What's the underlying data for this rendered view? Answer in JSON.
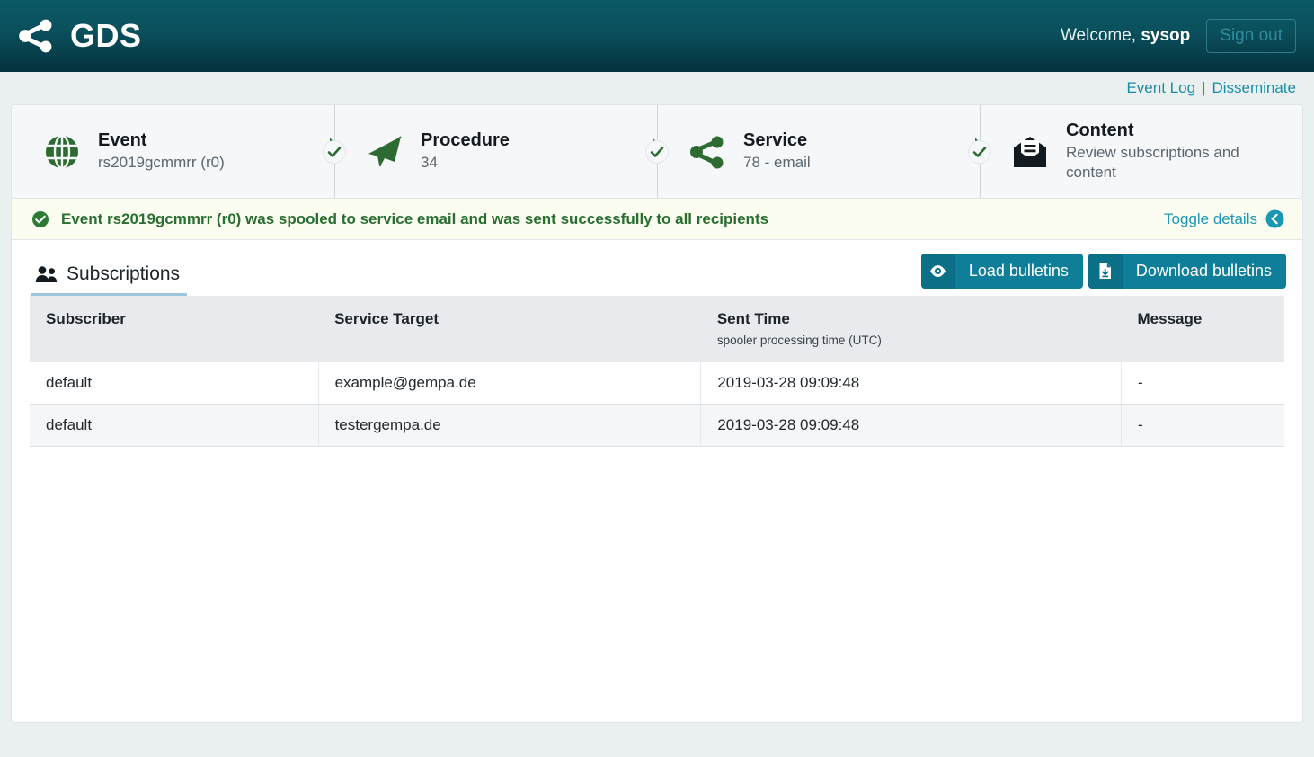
{
  "header": {
    "logo_icon": "share-nodes-icon",
    "title": "GDS",
    "welcome_prefix": "Welcome, ",
    "username": "sysop",
    "signout_label": "Sign out",
    "brand_color": "#04323d",
    "accent_color": "#0e7e99"
  },
  "nav": {
    "links": [
      {
        "label": "Event Log"
      },
      {
        "label": "Disseminate"
      }
    ],
    "separator": "|"
  },
  "steps": [
    {
      "icon": "globe-icon",
      "title": "Event",
      "subtitle": "rs2019gcmmrr (r0)",
      "completed": true
    },
    {
      "icon": "paper-plane-icon",
      "title": "Procedure",
      "subtitle": "34",
      "completed": true
    },
    {
      "icon": "share-nodes-icon",
      "title": "Service",
      "subtitle": "78 - email",
      "completed": true
    },
    {
      "icon": "envelope-open-text-icon",
      "title": "Content",
      "subtitle": "Review subscriptions and content",
      "completed": false
    }
  ],
  "alert": {
    "icon": "check-circle-icon",
    "message": "Event rs2019gcmmrr (r0) was spooled to service email and was sent successfully to all recipients",
    "toggle_label": "Toggle details",
    "toggle_icon": "chevron-circle-left-icon",
    "text_color": "#2b6e32"
  },
  "panel": {
    "tab": {
      "icon": "users-icon",
      "label": "Subscriptions"
    },
    "buttons": [
      {
        "icon": "eye-icon",
        "label": "Load bulletins"
      },
      {
        "icon": "file-download-icon",
        "label": "Download bulletins"
      }
    ]
  },
  "table": {
    "columns": [
      {
        "label": "Subscriber",
        "sub": ""
      },
      {
        "label": "Service Target",
        "sub": ""
      },
      {
        "label": "Sent Time",
        "sub": "spooler processing time (UTC)"
      },
      {
        "label": "Message",
        "sub": ""
      }
    ],
    "rows": [
      {
        "subscriber": "default",
        "service_target": "example@gempa.de",
        "sent_time": "2019-03-28 09:09:48",
        "message": "-"
      },
      {
        "subscriber": "default",
        "service_target": "testergempa.de",
        "sent_time": "2019-03-28 09:09:48",
        "message": "-"
      }
    ]
  }
}
